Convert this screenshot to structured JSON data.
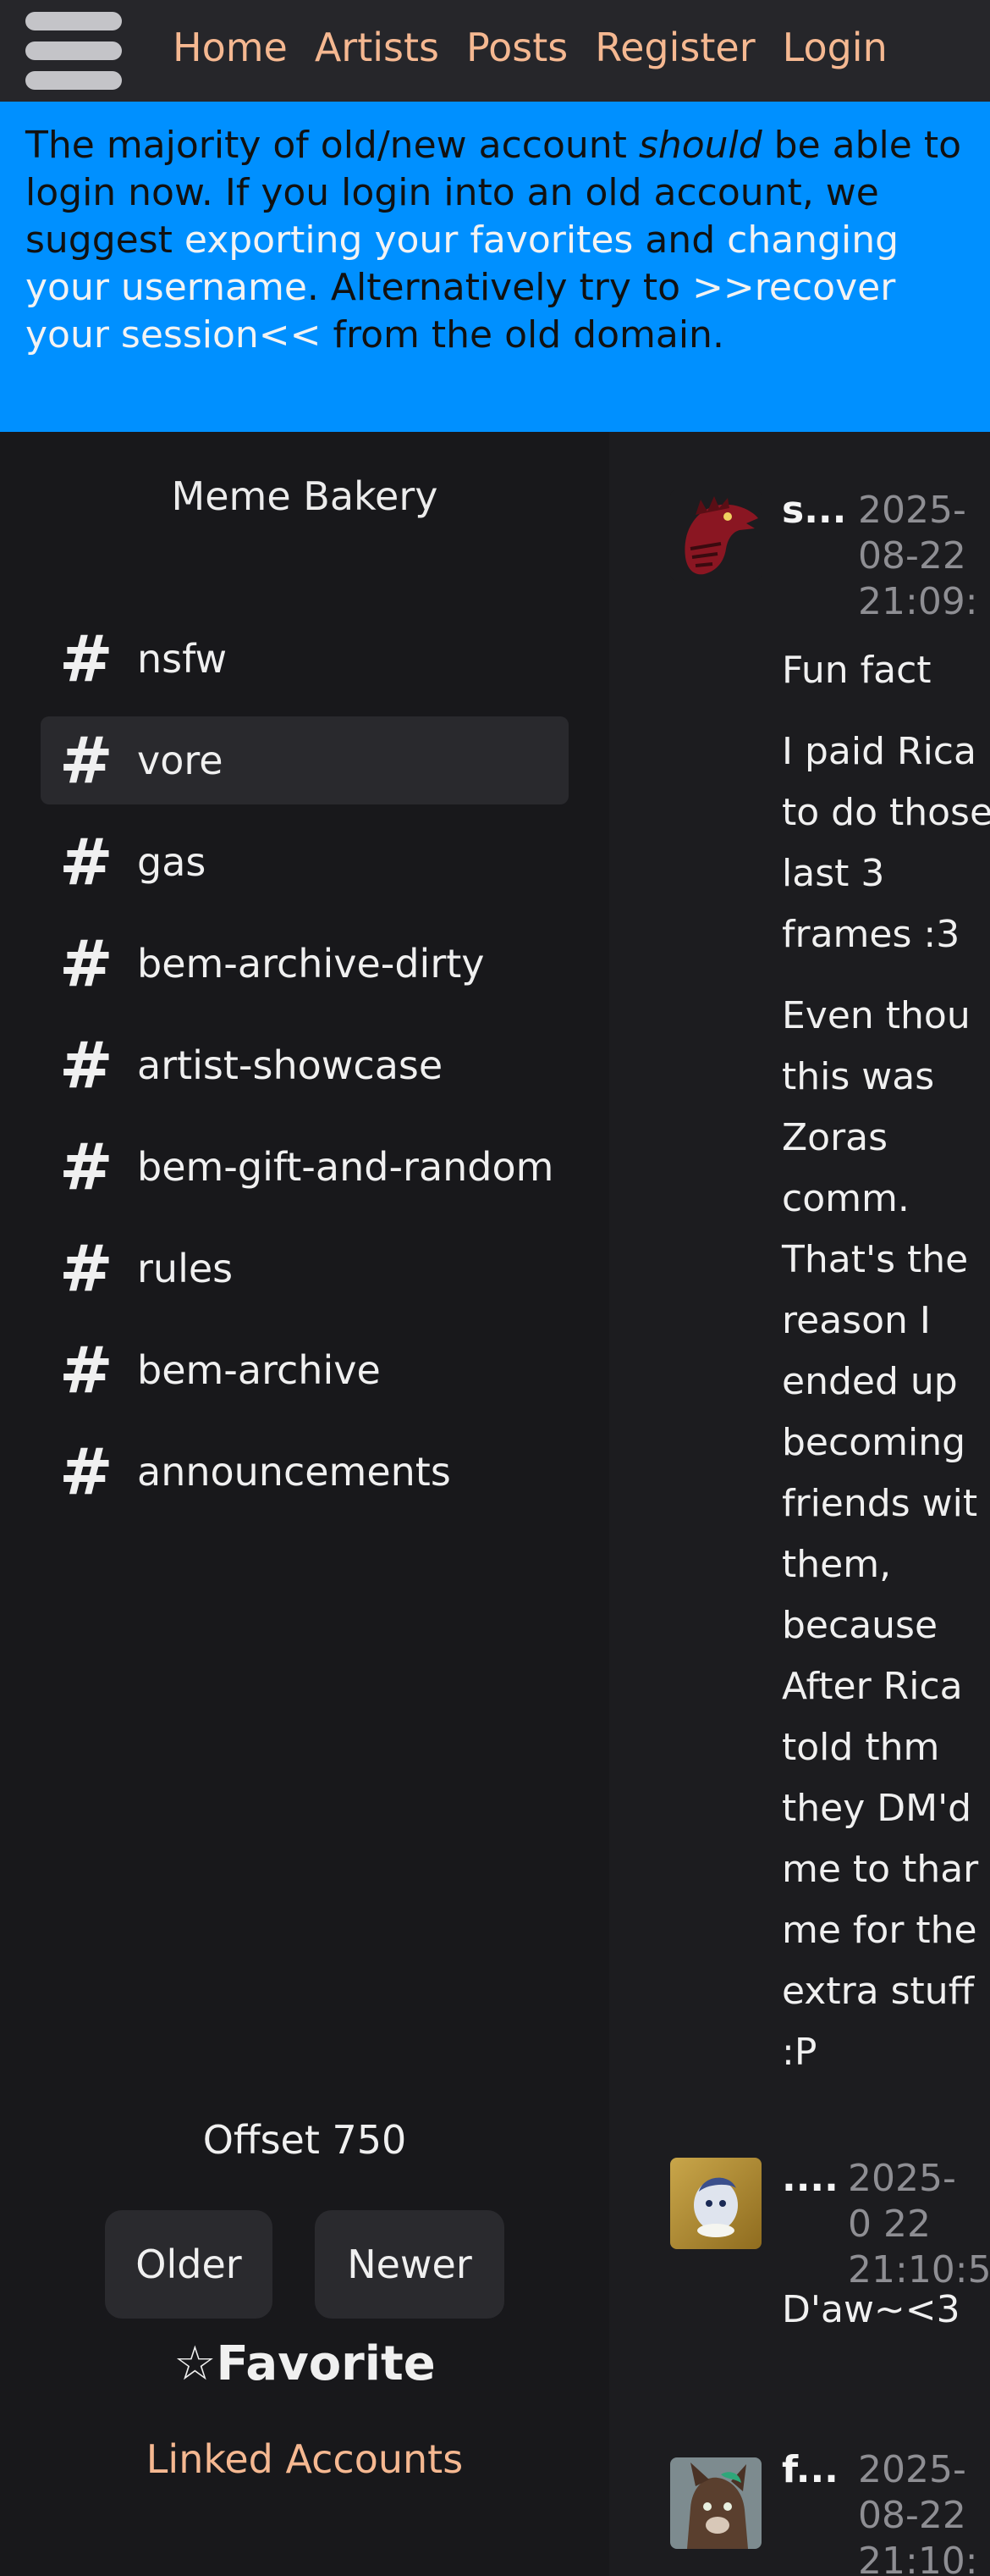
{
  "nav": {
    "links": [
      "Home",
      "Artists",
      "Posts",
      "Register",
      "Login"
    ]
  },
  "banner": {
    "part1": "The majority of old/new account ",
    "part2_em": "should",
    "part3": " be able to login now. If you login into an old account, we suggest ",
    "link1": "exporting your favorites",
    "part4": " and ",
    "link2": "changing your username",
    "part5": ". Alternatively try to ",
    "link3": ">>recover your session<<",
    "part6": " from the old domain."
  },
  "sidebar": {
    "title": "Meme Bakery",
    "channels": [
      {
        "name": "nsfw",
        "active": false
      },
      {
        "name": "vore",
        "active": true
      },
      {
        "name": "gas",
        "active": false
      },
      {
        "name": "bem-archive-dirty",
        "active": false
      },
      {
        "name": "artist-showcase",
        "active": false
      },
      {
        "name": "bem-gift-and-random",
        "active": false
      },
      {
        "name": "rules",
        "active": false
      },
      {
        "name": "bem-archive",
        "active": false
      },
      {
        "name": "announcements",
        "active": false
      }
    ],
    "hash_symbol": "#",
    "offset": "Offset 750",
    "older": "Older",
    "newer": "Newer",
    "favorite_star": "☆",
    "favorite": "Favorite",
    "linked_accounts": "Linked Accounts"
  },
  "messages": [
    {
      "author": "s...",
      "timestamp": "2025-08-22 21:09:",
      "paragraphs": [
        "Fun fact",
        "I paid Rica to do those last 3 frames :3",
        "Even thou this was Zoras comm. That's the reason I ended up becoming friends wit them, because After Rica told thm they DM'd me to thar me for the extra stuff :P"
      ]
    },
    {
      "author": "....",
      "timestamp": "2025-0 22 21:10:5",
      "paragraphs": [
        "D'aw~<3"
      ]
    },
    {
      "author": "f...",
      "timestamp": "2025-08-22 21:10:",
      "paragraphs": []
    }
  ],
  "colors": {
    "nav_bg": "#26262a",
    "link": "#f5b891",
    "banner_bg": "#0090ff",
    "sidebar_bg": "#18181b",
    "messages_bg": "#1c1c1f"
  }
}
